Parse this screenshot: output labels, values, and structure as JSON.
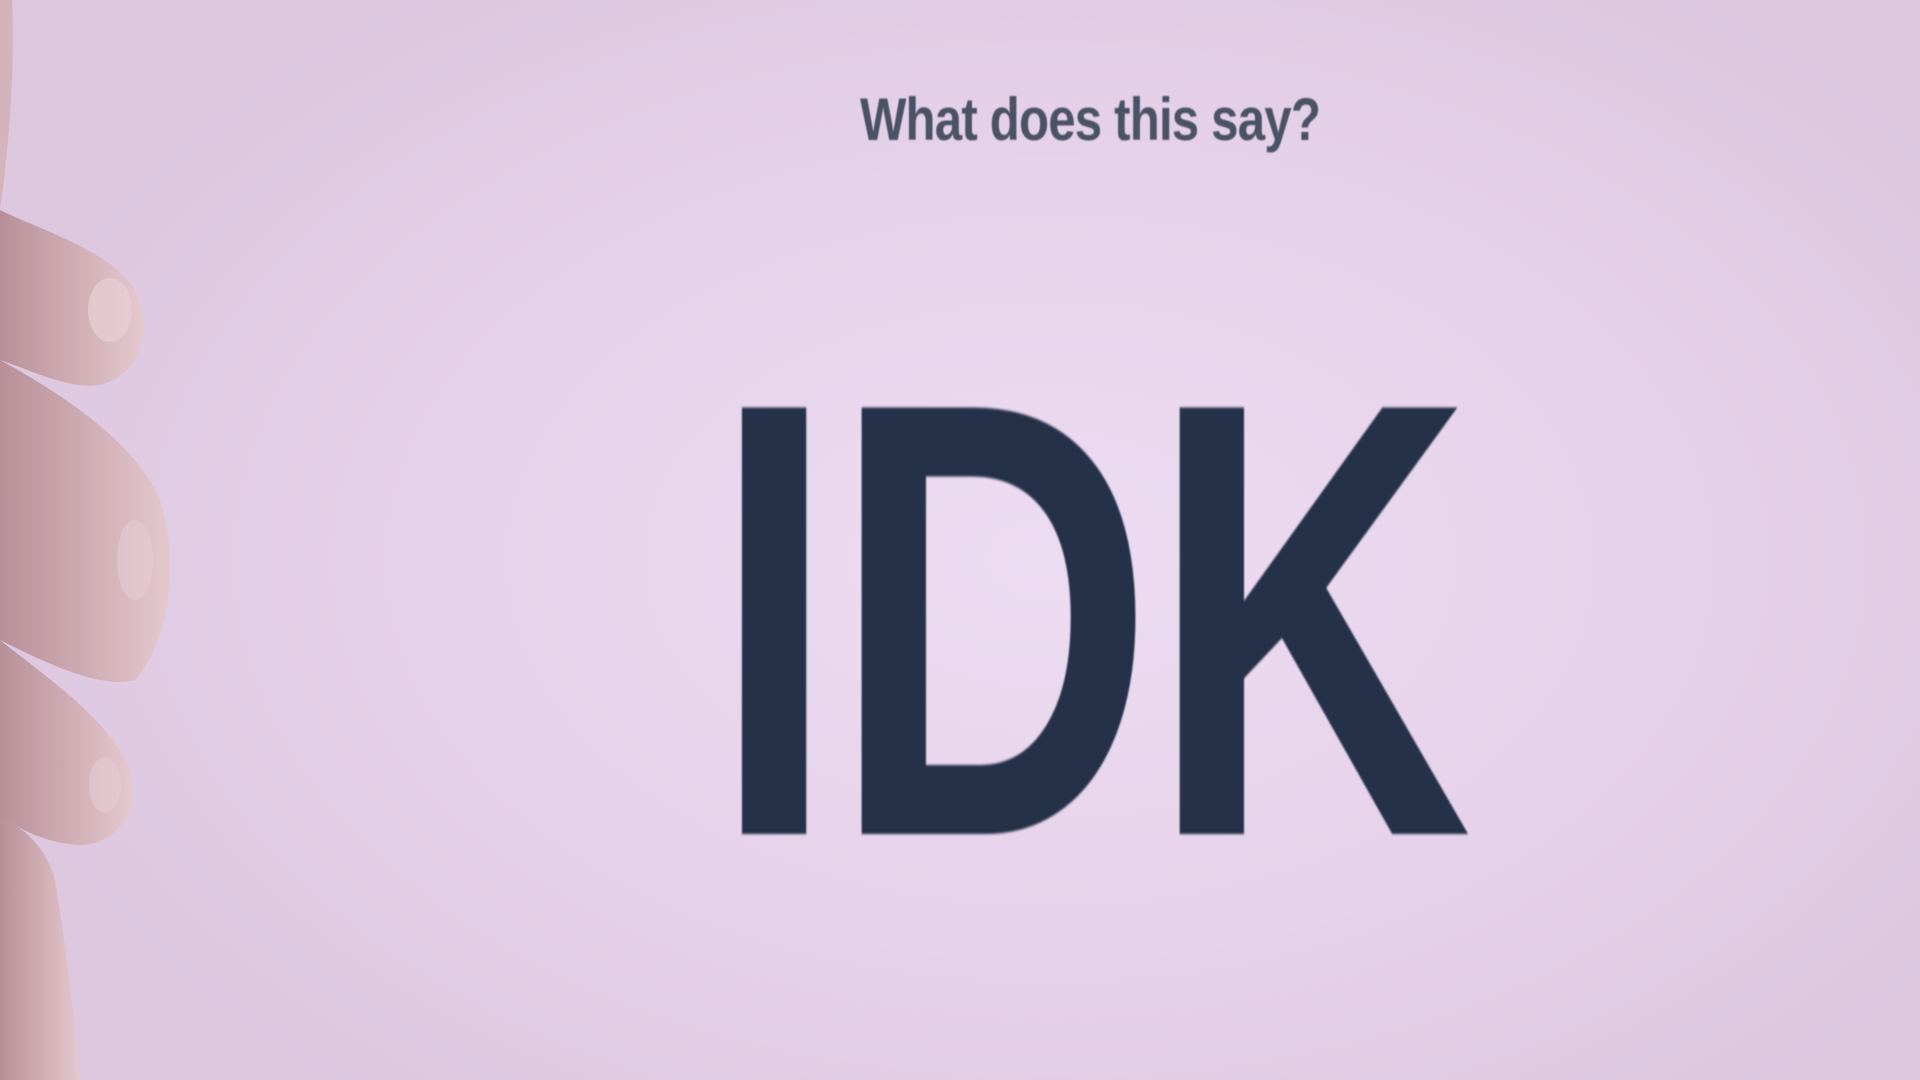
{
  "card": {
    "question": "What does this say?",
    "headline": "IDK"
  },
  "colors": {
    "paper": "#e7d6ec",
    "text": "#253148",
    "question_text": "#4a5266",
    "skin": "#c9a6ad"
  },
  "icons": [
    "hand"
  ]
}
